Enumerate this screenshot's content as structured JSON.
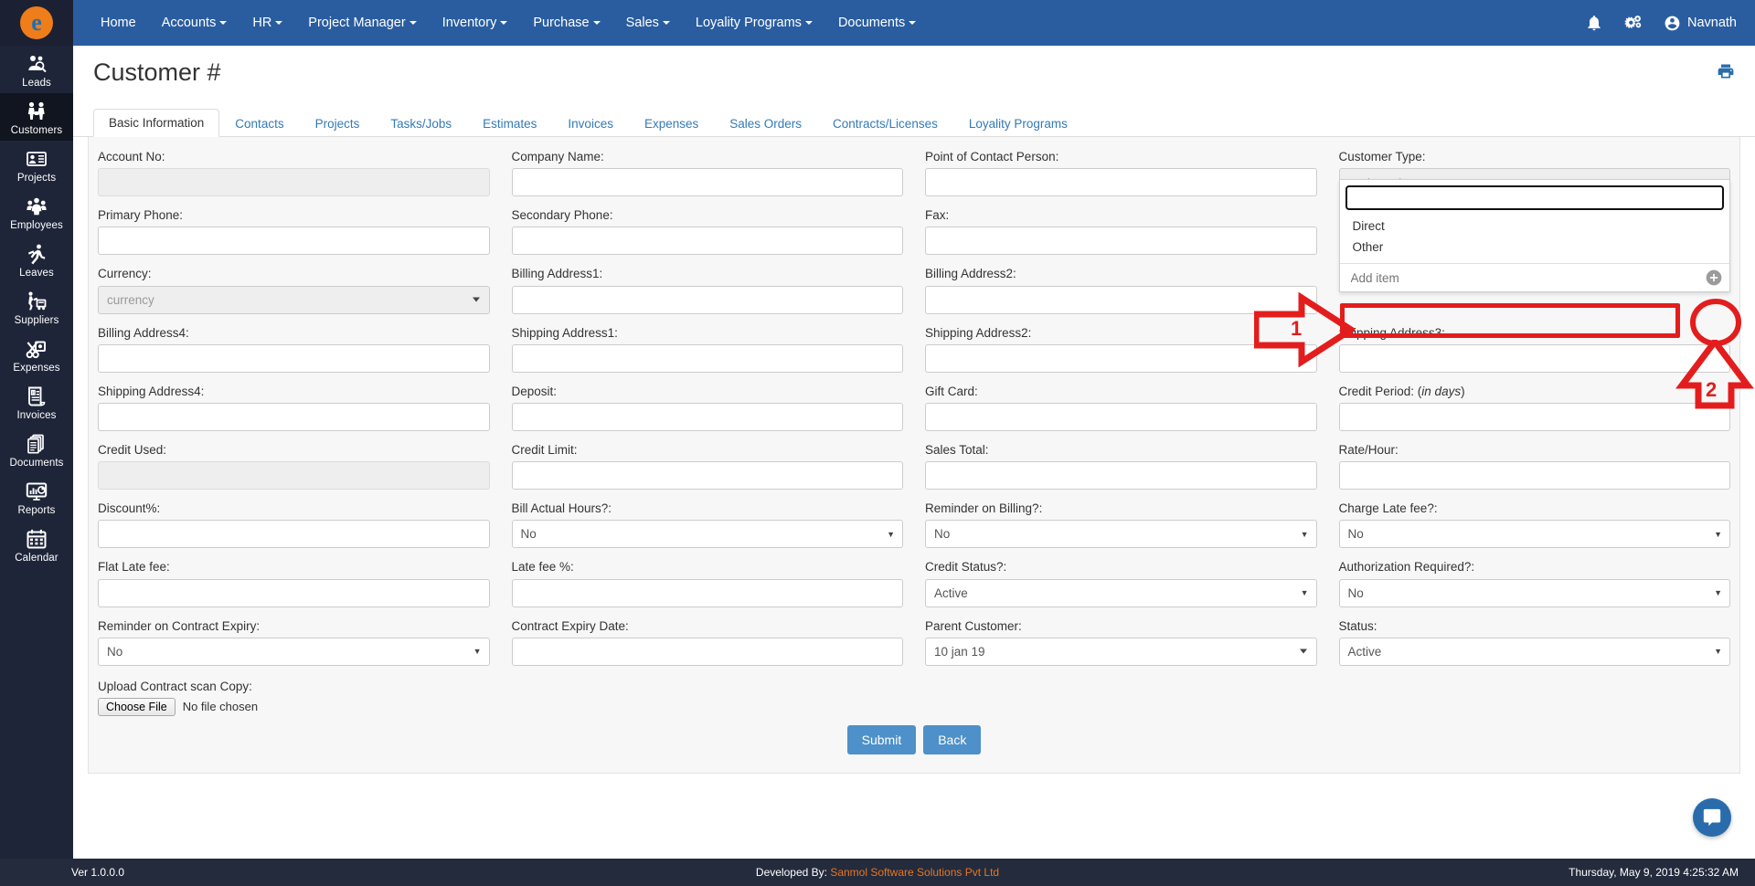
{
  "app": {
    "brand_letter": "e",
    "user_name": "Navnath"
  },
  "topnav": {
    "items": [
      {
        "label": "Home",
        "has_caret": false
      },
      {
        "label": "Accounts",
        "has_caret": true
      },
      {
        "label": "HR",
        "has_caret": true
      },
      {
        "label": "Project Manager",
        "has_caret": true
      },
      {
        "label": "Inventory",
        "has_caret": true
      },
      {
        "label": "Purchase",
        "has_caret": true
      },
      {
        "label": "Sales",
        "has_caret": true
      },
      {
        "label": "Loyality Programs",
        "has_caret": true
      },
      {
        "label": "Documents",
        "has_caret": true
      }
    ]
  },
  "sidebar": {
    "items": [
      {
        "label": "Leads",
        "icon": "leads-icon",
        "active": false
      },
      {
        "label": "Customers",
        "icon": "customers-icon",
        "active": true
      },
      {
        "label": "Projects",
        "icon": "projects-icon",
        "active": false
      },
      {
        "label": "Employees",
        "icon": "employees-icon",
        "active": false
      },
      {
        "label": "Leaves",
        "icon": "leaves-icon",
        "active": false
      },
      {
        "label": "Suppliers",
        "icon": "suppliers-icon",
        "active": false
      },
      {
        "label": "Expenses",
        "icon": "expenses-icon",
        "active": false
      },
      {
        "label": "Invoices",
        "icon": "invoices-icon",
        "active": false
      },
      {
        "label": "Documents",
        "icon": "documents-icon",
        "active": false
      },
      {
        "label": "Reports",
        "icon": "reports-icon",
        "active": false
      },
      {
        "label": "Calendar",
        "icon": "calendar-icon",
        "active": false
      }
    ]
  },
  "page": {
    "title": "Customer #",
    "tabs": [
      {
        "label": "Basic Information",
        "active": true
      },
      {
        "label": "Contacts",
        "active": false
      },
      {
        "label": "Projects",
        "active": false
      },
      {
        "label": "Tasks/Jobs",
        "active": false
      },
      {
        "label": "Estimates",
        "active": false
      },
      {
        "label": "Invoices",
        "active": false
      },
      {
        "label": "Expenses",
        "active": false
      },
      {
        "label": "Sales Orders",
        "active": false
      },
      {
        "label": "Contracts/Licenses",
        "active": false
      },
      {
        "label": "Loyality Programs",
        "active": false
      }
    ]
  },
  "form": {
    "row1": [
      {
        "label": "Account No:",
        "value": "",
        "type": "readonly"
      },
      {
        "label": "Company Name:",
        "value": "",
        "type": "text"
      },
      {
        "label": "Point of Contact Person:",
        "value": "",
        "type": "text"
      },
      {
        "label": "Customer Type:",
        "value": "customertype",
        "type": "select2-open"
      }
    ],
    "row2": [
      {
        "label": "Primary Phone:",
        "value": "",
        "type": "text"
      },
      {
        "label": "Secondary Phone:",
        "value": "",
        "type": "text"
      },
      {
        "label": "Fax:",
        "value": "",
        "type": "text"
      },
      {
        "label": "",
        "value": "",
        "type": "hidden"
      }
    ],
    "row3": [
      {
        "label": "Currency:",
        "value": "currency",
        "type": "select2"
      },
      {
        "label": "Billing Address1:",
        "value": "",
        "type": "text"
      },
      {
        "label": "Billing Address2:",
        "value": "",
        "type": "text"
      },
      {
        "label": "",
        "value": "",
        "type": "hidden"
      }
    ],
    "row4": [
      {
        "label": "Billing Address4:",
        "value": "",
        "type": "text"
      },
      {
        "label": "Shipping Address1:",
        "value": "",
        "type": "text"
      },
      {
        "label": "Shipping Address2:",
        "value": "",
        "type": "text"
      },
      {
        "label": "Shipping Address3:",
        "value": "",
        "type": "text"
      }
    ],
    "row5": [
      {
        "label": "Shipping Address4:",
        "value": "",
        "type": "text"
      },
      {
        "label": "Deposit:",
        "value": "",
        "type": "text"
      },
      {
        "label": "Gift Card:",
        "value": "",
        "type": "text"
      },
      {
        "label": "Credit Period: (in days)",
        "value": "",
        "type": "text",
        "italic_part": "in days"
      }
    ],
    "row6": [
      {
        "label": "Credit Used:",
        "value": "",
        "type": "readonly"
      },
      {
        "label": "Credit Limit:",
        "value": "",
        "type": "text"
      },
      {
        "label": "Sales Total:",
        "value": "",
        "type": "text"
      },
      {
        "label": "Rate/Hour:",
        "value": "",
        "type": "text"
      }
    ],
    "row7": [
      {
        "label": "Discount%:",
        "value": "",
        "type": "text"
      },
      {
        "label": "Bill Actual Hours?:",
        "value": "No",
        "type": "select"
      },
      {
        "label": "Reminder on Billing?:",
        "value": "No",
        "type": "select"
      },
      {
        "label": "Charge Late fee?:",
        "value": "No",
        "type": "select"
      }
    ],
    "row8": [
      {
        "label": "Flat Late fee:",
        "value": "",
        "type": "text"
      },
      {
        "label": "Late fee %:",
        "value": "",
        "type": "text"
      },
      {
        "label": "Credit Status?:",
        "value": "Active",
        "type": "select"
      },
      {
        "label": "Authorization Required?:",
        "value": "No",
        "type": "select"
      }
    ],
    "row9": [
      {
        "label": "Reminder on Contract Expiry:",
        "value": "No",
        "type": "select"
      },
      {
        "label": "Contract Expiry Date:",
        "value": "",
        "type": "text"
      },
      {
        "label": "Parent Customer:",
        "value": "10 jan 19",
        "type": "select2-white"
      },
      {
        "label": "Status:",
        "value": "Active",
        "type": "select"
      }
    ],
    "upload": {
      "label": "Upload Contract scan Copy:",
      "button": "Choose File",
      "status": "No file chosen"
    },
    "buttons": {
      "submit": "Submit",
      "back": "Back"
    }
  },
  "customer_type_dropdown": {
    "search_value": "",
    "options": [
      "Direct",
      "Other"
    ],
    "add_item_placeholder": "Add item",
    "add_button_icon": "plus-circle-icon"
  },
  "annotations": [
    {
      "number": "1",
      "target": "add-item-input"
    },
    {
      "number": "2",
      "target": "add-item-plus-button"
    }
  ],
  "footer": {
    "version": "Ver 1.0.0.0",
    "developed_by_label": "Developed By:",
    "developed_by_name": "Sanmol Software Solutions Pvt Ltd",
    "datetime": "Thursday, May 9, 2019 4:25:32 AM"
  },
  "colors": {
    "nav_blue": "#2a5d9f",
    "sidebar_dark": "#1f2539",
    "accent_orange": "#ef7d1a",
    "annotation_red": "#e31d1d",
    "button_blue": "#4e90c9"
  }
}
